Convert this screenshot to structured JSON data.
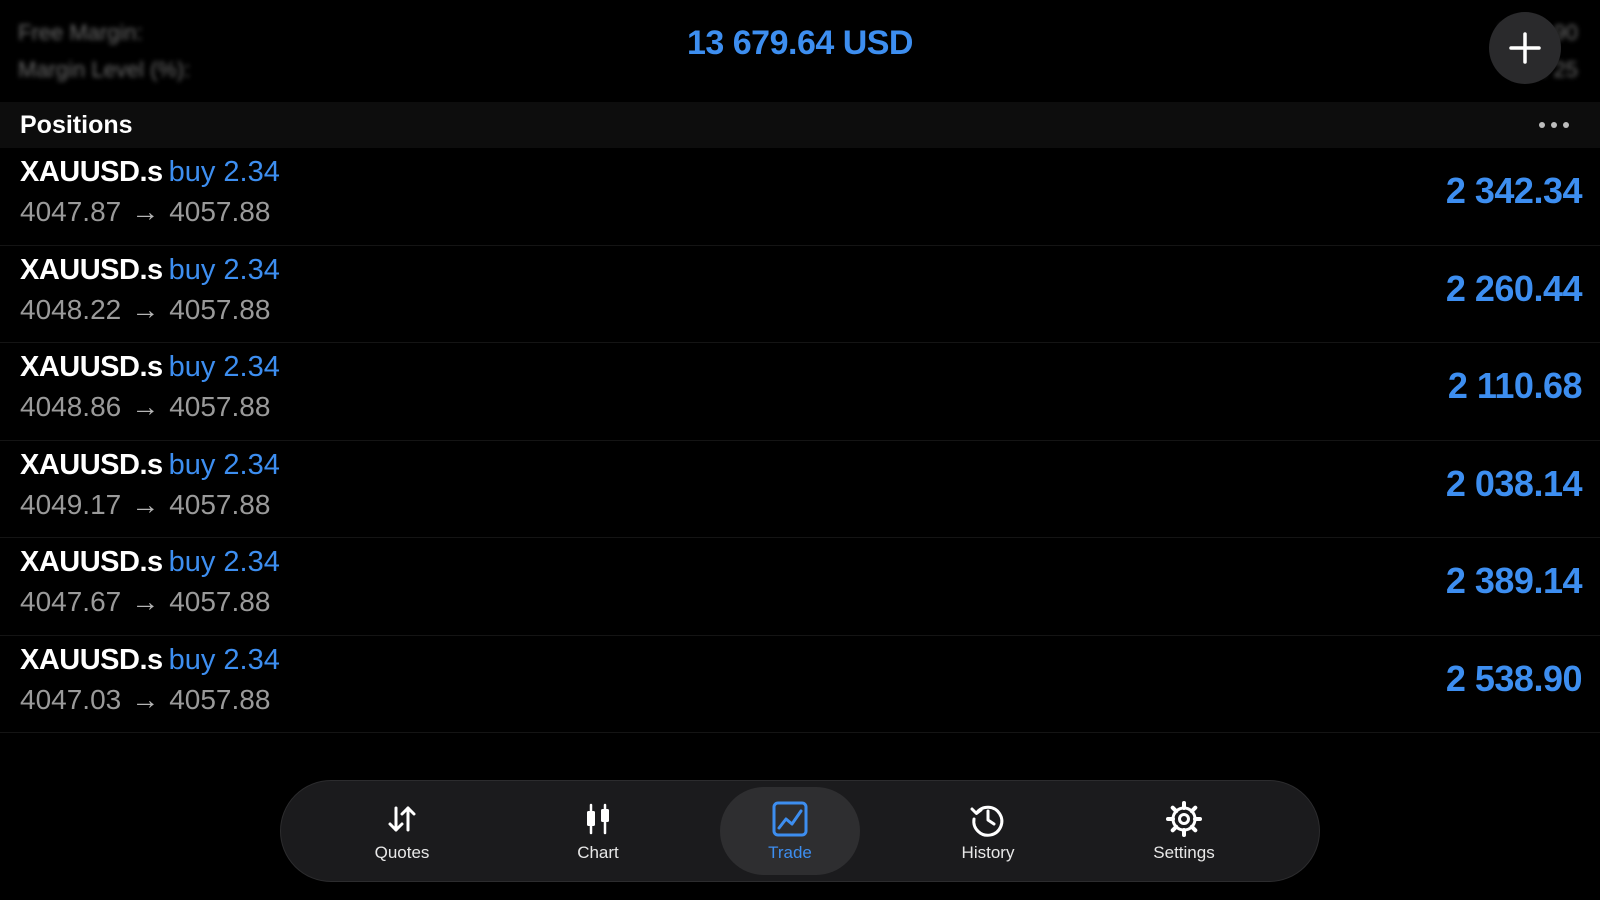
{
  "header": {
    "margin_labels": [
      "Free Margin:",
      "Margin Level (%):"
    ],
    "margin_values": [
      "5486.90",
      "4 25"
    ],
    "total_profit": "13 679.64 USD",
    "add_icon": "plus-icon"
  },
  "positions": {
    "title": "Positions",
    "more_icon": "more-horizontal-icon",
    "items": [
      {
        "symbol": "XAUUSD.s",
        "side": "buy",
        "lots": "2.34",
        "open_price": "4047.87",
        "current_price": "4057.88",
        "profit": "2 342.34"
      },
      {
        "symbol": "XAUUSD.s",
        "side": "buy",
        "lots": "2.34",
        "open_price": "4048.22",
        "current_price": "4057.88",
        "profit": "2 260.44"
      },
      {
        "symbol": "XAUUSD.s",
        "side": "buy",
        "lots": "2.34",
        "open_price": "4048.86",
        "current_price": "4057.88",
        "profit": "2 110.68"
      },
      {
        "symbol": "XAUUSD.s",
        "side": "buy",
        "lots": "2.34",
        "open_price": "4049.17",
        "current_price": "4057.88",
        "profit": "2 038.14"
      },
      {
        "symbol": "XAUUSD.s",
        "side": "buy",
        "lots": "2.34",
        "open_price": "4047.67",
        "current_price": "4057.88",
        "profit": "2 389.14"
      },
      {
        "symbol": "XAUUSD.s",
        "side": "buy",
        "lots": "2.34",
        "open_price": "4047.03",
        "current_price": "4057.88",
        "profit": "2 538.90"
      }
    ],
    "arrow": "→"
  },
  "tabbar": {
    "tabs": [
      {
        "label": "Quotes",
        "icon": "quotes-arrows-icon",
        "active": false
      },
      {
        "label": "Chart",
        "icon": "candlestick-chart-icon",
        "active": false
      },
      {
        "label": "Trade",
        "icon": "trade-line-chart-icon",
        "active": true
      },
      {
        "label": "History",
        "icon": "history-clock-icon",
        "active": false
      },
      {
        "label": "Settings",
        "icon": "gear-icon",
        "active": false
      }
    ]
  },
  "colors": {
    "accent": "#3d8ef0",
    "background": "#000000",
    "secondary_text": "#9a9a9a",
    "tabbar_bg": "#1b1b1d"
  }
}
